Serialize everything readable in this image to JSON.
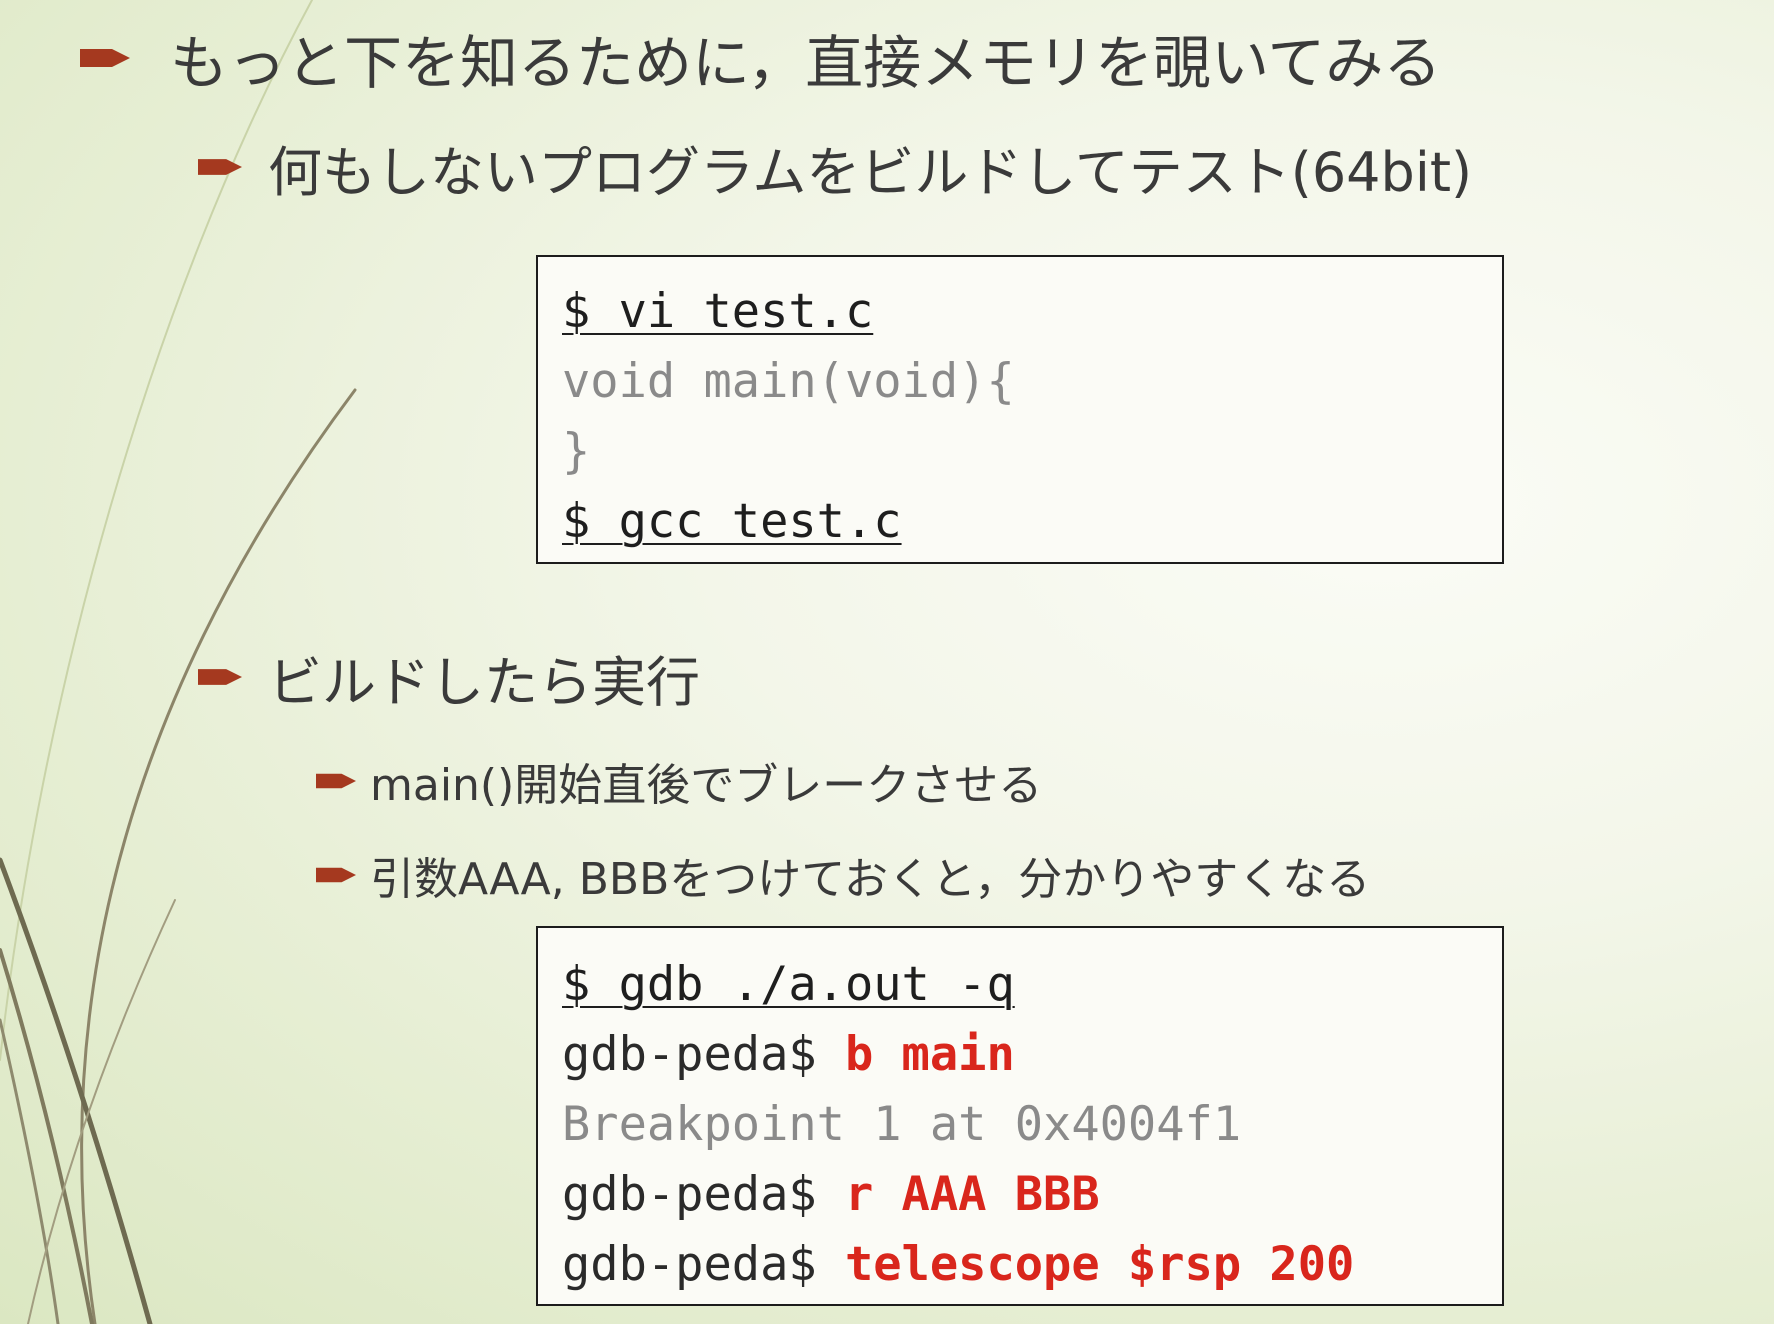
{
  "colors": {
    "bullet": "#a5391f",
    "command_red": "#d9261c",
    "muted_text": "#8a8a8a",
    "text": "#3a3a3a"
  },
  "icons": {
    "bullet": "arrow-bullet-icon"
  },
  "bullets": {
    "main": "もっと下を知るために，直接メモリを覗いてみる",
    "build": "何もしないプログラムをビルドしてテスト(64bit)",
    "run": "ビルドしたら実行",
    "break": "main()開始直後でブレークさせる",
    "args": "引数AAA, BBBをつけておくと，分かりやすくなる"
  },
  "code1": {
    "line1": "$ vi test.c",
    "line2": "void main(void){",
    "line3": "}",
    "line4": "$ gcc test.c"
  },
  "code2": {
    "line1": "$ gdb ./a.out -q",
    "prompt": "gdb-peda$ ",
    "cmd_break": "b main",
    "result": "Breakpoint 1 at 0x4004f1",
    "cmd_run": "r AAA BBB",
    "cmd_telescope": "telescope $rsp 200"
  }
}
